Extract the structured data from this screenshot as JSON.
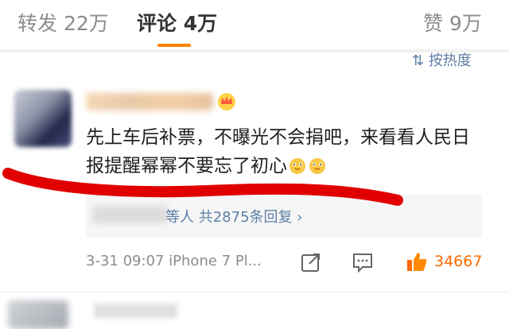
{
  "tabs": {
    "repost": "转发 22万",
    "comment": "评论 4万",
    "like": "赞 9万"
  },
  "sort_label": "按热度",
  "comment": {
    "text": "先上车后补票，不曝光不会捐吧，来看看人民日报提醒幂幂不要忘了初心",
    "replies_label": "等人 共2875条回复 ›",
    "meta": "3-31 09:07 iPhone 7 Pl...",
    "like_count": "34667"
  },
  "colors": {
    "accent": "#ff8200",
    "link": "#5b7fa6",
    "like": "#ff6a00",
    "annotation": "#e00000"
  },
  "icons": [
    "crown-icon",
    "dog-emoji-icon",
    "share-icon",
    "comment-icon",
    "thumbs-up-icon"
  ]
}
